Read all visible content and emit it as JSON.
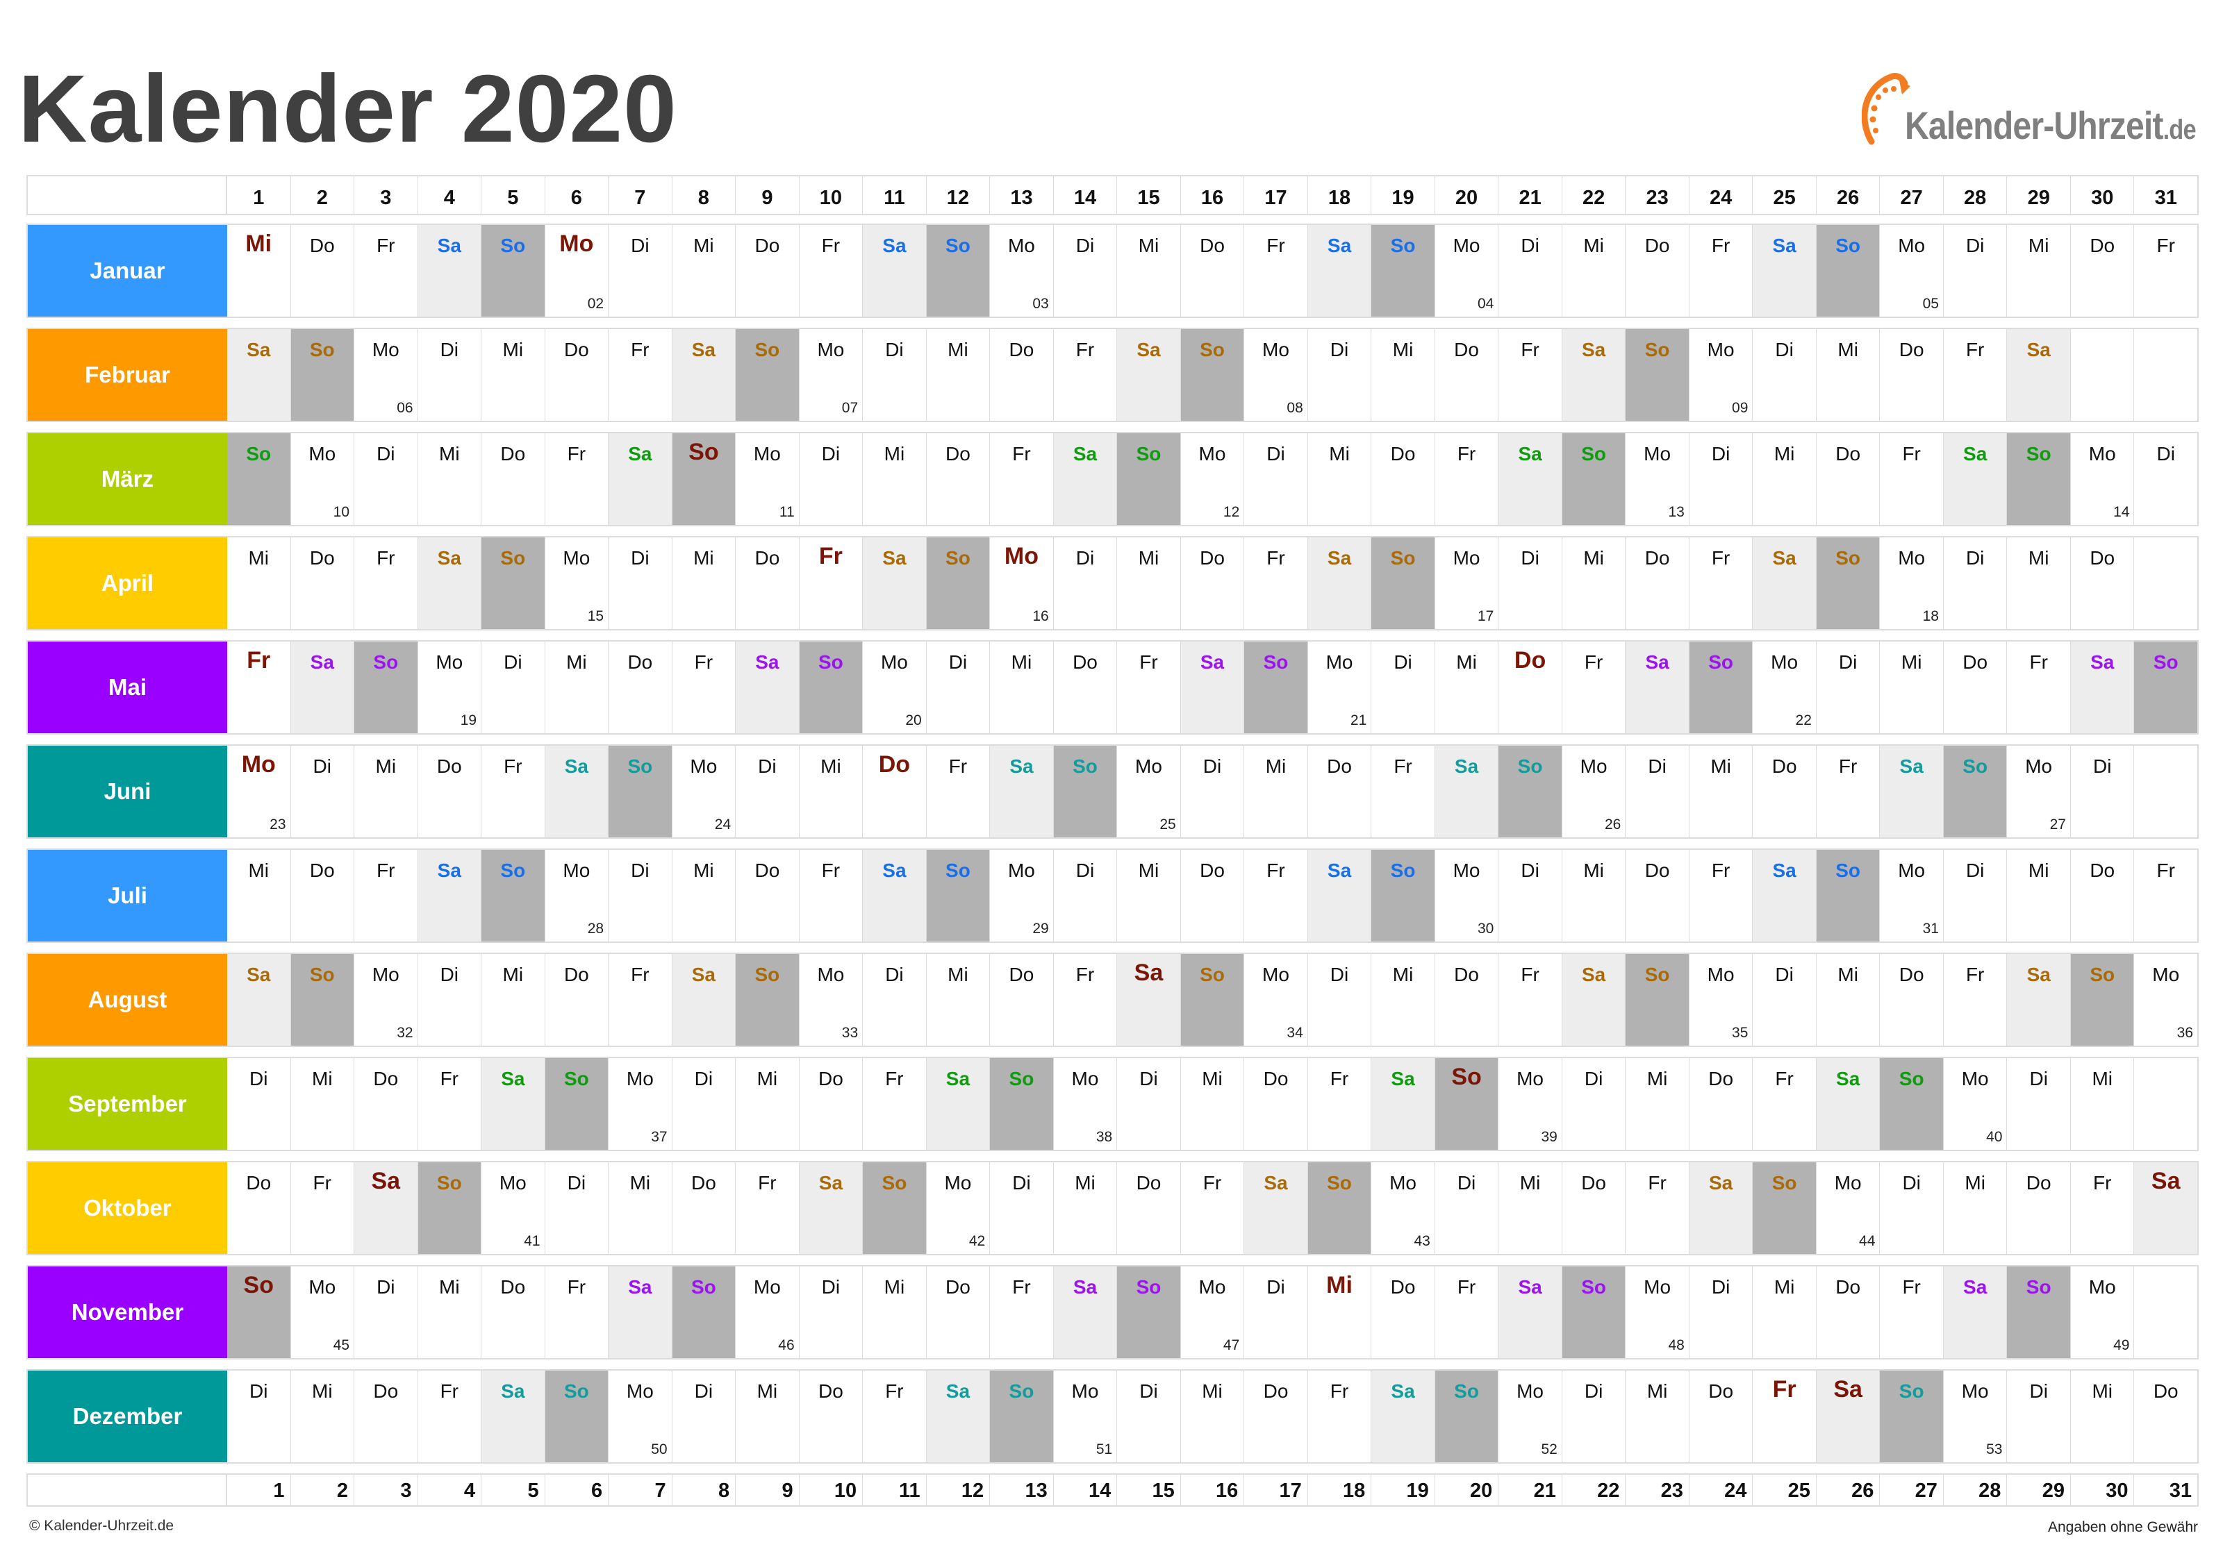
{
  "title": "Kalender 2020",
  "logo": {
    "brand": "Kalender-Uhrzeit",
    "tld": ".de",
    "icon": "clock-arrow-icon",
    "accent": "#f37b20"
  },
  "day_header": [
    "1",
    "2",
    "3",
    "4",
    "5",
    "6",
    "7",
    "8",
    "9",
    "10",
    "11",
    "12",
    "13",
    "14",
    "15",
    "16",
    "17",
    "18",
    "19",
    "20",
    "21",
    "22",
    "23",
    "24",
    "25",
    "26",
    "27",
    "28",
    "29",
    "30",
    "31"
  ],
  "weekday_colors": {
    "default": "#111111",
    "holiday": "#7b1606",
    "saturday_bg": "#ededed",
    "sunday_bg": "#b2b2b2"
  },
  "months": [
    {
      "name": "Januar",
      "color": "#3399ff",
      "weekend_text": "#1a6fe8",
      "first_weekday": "Mi",
      "days": 31,
      "holidays": [
        1,
        6
      ],
      "week_numbers": {
        "6": "02",
        "13": "03",
        "20": "04",
        "27": "05"
      }
    },
    {
      "name": "Februar",
      "color": "#ff9900",
      "weekend_text": "#a86b0c",
      "first_weekday": "Sa",
      "days": 29,
      "holidays": [],
      "week_numbers": {
        "3": "06",
        "10": "07",
        "17": "08",
        "24": "09"
      }
    },
    {
      "name": "März",
      "color": "#aed000",
      "weekend_text": "#129a12",
      "first_weekday": "So",
      "days": 31,
      "holidays": [
        8
      ],
      "week_numbers": {
        "2": "10",
        "9": "11",
        "16": "12",
        "23": "13",
        "30": "14"
      }
    },
    {
      "name": "April",
      "color": "#ffcc00",
      "weekend_text": "#a86b0c",
      "first_weekday": "Mi",
      "days": 30,
      "holidays": [
        10,
        13
      ],
      "week_numbers": {
        "6": "15",
        "13": "16",
        "20": "17",
        "27": "18"
      }
    },
    {
      "name": "Mai",
      "color": "#9900ff",
      "weekend_text": "#9b14ee",
      "first_weekday": "Fr",
      "days": 31,
      "holidays": [
        1,
        21
      ],
      "week_numbers": {
        "4": "19",
        "11": "20",
        "18": "21",
        "25": "22"
      }
    },
    {
      "name": "Juni",
      "color": "#009999",
      "weekend_text": "#149b9b",
      "first_weekday": "Mo",
      "days": 30,
      "holidays": [
        1,
        11
      ],
      "week_numbers": {
        "1": "23",
        "8": "24",
        "15": "25",
        "22": "26",
        "29": "27"
      }
    },
    {
      "name": "Juli",
      "color": "#3399ff",
      "weekend_text": "#1a6fe8",
      "first_weekday": "Mi",
      "days": 31,
      "holidays": [],
      "week_numbers": {
        "6": "28",
        "13": "29",
        "20": "30",
        "27": "31"
      }
    },
    {
      "name": "August",
      "color": "#ff9900",
      "weekend_text": "#a86b0c",
      "first_weekday": "Sa",
      "days": 31,
      "holidays": [
        15
      ],
      "week_numbers": {
        "3": "32",
        "10": "33",
        "17": "34",
        "24": "35",
        "31": "36"
      }
    },
    {
      "name": "September",
      "color": "#aed000",
      "weekend_text": "#129a12",
      "first_weekday": "Di",
      "days": 30,
      "holidays": [
        20
      ],
      "week_numbers": {
        "7": "37",
        "14": "38",
        "21": "39",
        "28": "40"
      }
    },
    {
      "name": "Oktober",
      "color": "#ffcc00",
      "weekend_text": "#a86b0c",
      "first_weekday": "Do",
      "days": 31,
      "holidays": [
        3,
        31
      ],
      "week_numbers": {
        "5": "41",
        "12": "42",
        "19": "43",
        "26": "44"
      }
    },
    {
      "name": "November",
      "color": "#9900ff",
      "weekend_text": "#9b14ee",
      "first_weekday": "So",
      "days": 30,
      "holidays": [
        1,
        18
      ],
      "week_numbers": {
        "2": "45",
        "9": "46",
        "16": "47",
        "23": "48",
        "30": "49"
      }
    },
    {
      "name": "Dezember",
      "color": "#009999",
      "weekend_text": "#149b9b",
      "first_weekday": "Di",
      "days": 31,
      "holidays": [
        25,
        26
      ],
      "week_numbers": {
        "7": "50",
        "14": "51",
        "21": "52",
        "28": "53"
      }
    }
  ],
  "weekdays": [
    "Mo",
    "Di",
    "Mi",
    "Do",
    "Fr",
    "Sa",
    "So"
  ],
  "footer": {
    "copyright": "© Kalender-Uhrzeit.de",
    "disclaimer": "Angaben ohne Gewähr"
  }
}
